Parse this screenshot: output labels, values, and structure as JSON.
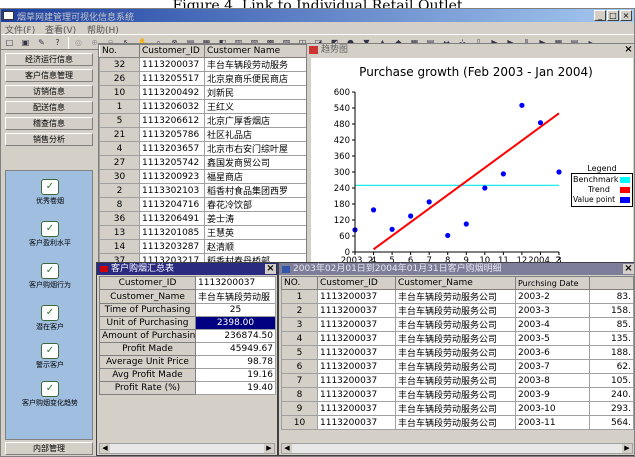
{
  "figure": {
    "caption": "Figure 4. Link to Individual Retail Outlet"
  },
  "window": {
    "title": "烟草网建管理可视化信息系统"
  },
  "menu": [
    "文件(F)",
    "查看(V)",
    "帮助(H)"
  ],
  "sidebar": {
    "top_items": [
      "经济运行信息",
      "客户信息管理",
      "访销信息",
      "配送信息",
      "稽查信息",
      "销售分析"
    ],
    "icon_items": [
      {
        "label": "优秀卷烟",
        "icon": "award-icon"
      },
      {
        "label": "客户盈利水平",
        "icon": "profit-icon"
      },
      {
        "label": "客户购烟行为",
        "icon": "behavior-icon"
      },
      {
        "label": "潜在客户",
        "icon": "potential-icon"
      },
      {
        "label": "警示客户",
        "icon": "warning-icon"
      },
      {
        "label": "客户购烟变化趋势",
        "icon": "trend-icon"
      }
    ],
    "bottom_item": "内部管理"
  },
  "customer_grid": {
    "headers": [
      "No.",
      "Customer_ID",
      "Customer Name"
    ],
    "rows": [
      [
        "32",
        "1113200037",
        "丰台车辆段劳动服务"
      ],
      [
        "26",
        "1113205517",
        "北京泉商乐便民商店"
      ],
      [
        "10",
        "1113200492",
        "刘新民"
      ],
      [
        "1",
        "1113206032",
        "王红义"
      ],
      [
        "5",
        "1113206612",
        "北京广厚香烟店"
      ],
      [
        "21",
        "1113205786",
        "社区礼品店"
      ],
      [
        "4",
        "1113203657",
        "北京市右安门综叶屋"
      ],
      [
        "27",
        "1113205742",
        "鑫国发商贸公司"
      ],
      [
        "30",
        "1113200923",
        "福星商店"
      ],
      [
        "2",
        "1113302103",
        "稻香村食品集团西罗"
      ],
      [
        "8",
        "1113204716",
        "春花冷饮部"
      ],
      [
        "36",
        "1113206491",
        "姜士涛"
      ],
      [
        "13",
        "1113201085",
        "王慧英"
      ],
      [
        "14",
        "1113203287",
        "赵清顺"
      ],
      [
        "37",
        "1113203217",
        "稻香村春丹桥部"
      ]
    ]
  },
  "chart_window": {
    "title": "趋势图"
  },
  "chart_data": {
    "type": "scatter",
    "title": "Purchase growth (Feb 2003 - Jan 2004)",
    "x_tick_labels": [
      "2003. 2",
      "4",
      "5",
      "6",
      "7",
      "8",
      "9",
      "10",
      "11",
      "12",
      "2004. 2",
      "3"
    ],
    "y_ticks": [
      0,
      60,
      120,
      180,
      240,
      300,
      360,
      420,
      480,
      540,
      600
    ],
    "ylim": [
      0,
      600
    ],
    "series": [
      {
        "name": "Value point",
        "type": "points",
        "color": "#0000ff",
        "x": [
          1,
          2,
          3,
          4,
          5,
          6,
          7,
          8,
          9,
          10,
          11,
          12
        ],
        "y": [
          83,
          158,
          85,
          135,
          188,
          62,
          105,
          240,
          293,
          550,
          485,
          300
        ]
      },
      {
        "name": "Trend",
        "type": "line",
        "color": "#ff0000",
        "x": [
          2,
          12
        ],
        "y": [
          10,
          520
        ]
      },
      {
        "name": "Benchmark",
        "type": "hline",
        "color": "#00e8e8",
        "y": 250
      }
    ],
    "legend": {
      "title": "Legend",
      "items": [
        {
          "label": "Benchmark",
          "color": "#00ffff"
        },
        {
          "label": "Trend",
          "color": "#ff0000"
        },
        {
          "label": "Value point",
          "color": "#0000ff"
        }
      ]
    }
  },
  "summary_window": {
    "title": "客户购烟汇总表",
    "rows": [
      {
        "label": "Customer_ID",
        "value": "1113200037"
      },
      {
        "label": "Customer_Name",
        "value": "丰台车辆段劳动服"
      },
      {
        "label": "Time of Purchasing",
        "value": "25"
      },
      {
        "label": "Unit of Purchasing",
        "value": "2398.00"
      },
      {
        "label": "Amount of Purchasing",
        "value": "236874.50"
      },
      {
        "label": "Profit Made",
        "value": "45949.67"
      },
      {
        "label": "Average Unit Price",
        "value": "98.78"
      },
      {
        "label": "Avg Profit Made",
        "value": "19.16"
      },
      {
        "label": "Profit Rate (%)",
        "value": "19.40"
      }
    ]
  },
  "history_window": {
    "title": "2003年02月01日到2004年01月31日客户购烟明细",
    "headers": [
      "NO.",
      "Customer_ID",
      "Customer_Name",
      "Purchsing Date",
      ""
    ],
    "rows": [
      [
        "1",
        "1113200037",
        "丰台车辆段劳动服务公司",
        "2003-2",
        "83."
      ],
      [
        "2",
        "1113200037",
        "丰台车辆段劳动服务公司",
        "2003-3",
        "158."
      ],
      [
        "3",
        "1113200037",
        "丰台车辆段劳动服务公司",
        "2003-4",
        "85."
      ],
      [
        "4",
        "1113200037",
        "丰台车辆段劳动服务公司",
        "2003-5",
        "135."
      ],
      [
        "5",
        "1113200037",
        "丰台车辆段劳动服务公司",
        "2003-6",
        "188."
      ],
      [
        "6",
        "1113200037",
        "丰台车辆段劳动服务公司",
        "2003-7",
        "62."
      ],
      [
        "7",
        "1113200037",
        "丰台车辆段劳动服务公司",
        "2003-8",
        "105."
      ],
      [
        "8",
        "1113200037",
        "丰台车辆段劳动服务公司",
        "2003-9",
        "240."
      ],
      [
        "9",
        "1113200037",
        "丰台车辆段劳动服务公司",
        "2003-10",
        "293."
      ],
      [
        "10",
        "1113200037",
        "丰台车辆段劳动服务公司",
        "2003-11",
        "564."
      ]
    ]
  }
}
